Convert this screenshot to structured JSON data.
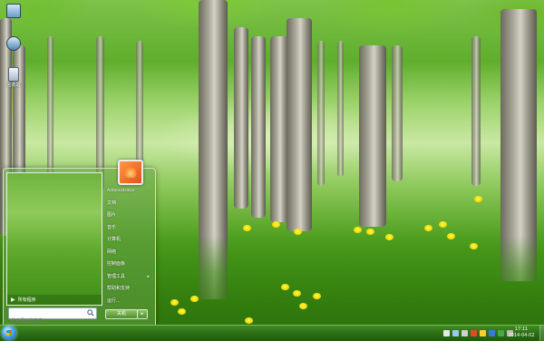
{
  "desktop": {
    "icons": [
      {
        "label": "",
        "icon": "computer-icon"
      },
      {
        "label": "",
        "icon": "network-icon"
      },
      {
        "label": "回收站",
        "icon": "recycle-bin-icon"
      }
    ]
  },
  "start_menu": {
    "all_programs_label": "所有程序",
    "search_placeholder": "搜索程序和文件",
    "right_items": [
      {
        "label": "Administrator",
        "key": "user"
      },
      {
        "label": "文档",
        "key": "documents"
      },
      {
        "label": "图片",
        "key": "pictures"
      },
      {
        "label": "音乐",
        "key": "music"
      },
      {
        "label": "计算机",
        "key": "computer"
      },
      {
        "label": "网络",
        "key": "network"
      },
      {
        "label": "控制面板",
        "key": "control-panel"
      },
      {
        "label": "管理工具",
        "key": "admin-tools",
        "has_submenu": true
      },
      {
        "label": "帮助和支持",
        "key": "help"
      },
      {
        "label": "运行...",
        "key": "run"
      }
    ],
    "shutdown_label": "关机",
    "shutdown_arrow": "▸",
    "user_picture": "orange-leaf-avatar"
  },
  "taskbar": {
    "start_button_icon": "windows-logo-icon",
    "tray_icons": [
      "flag-icon",
      "network-icon",
      "volume-icon",
      "security-icon",
      "app-icon-1",
      "app-icon-2",
      "app-icon-3",
      "app-icon-4"
    ],
    "clock_time": "17:11",
    "clock_date": "2014-04-02"
  },
  "colors": {
    "taskbar": "#2d6f15",
    "start_menu_border": "#dcefc8",
    "accent": "#4f9f1f"
  }
}
